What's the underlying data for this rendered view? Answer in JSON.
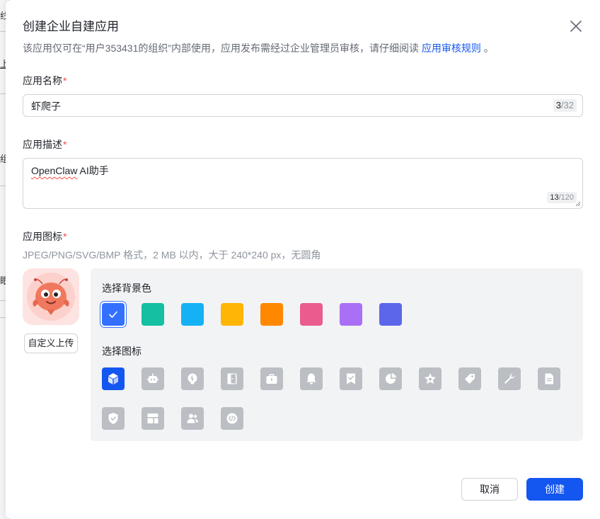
{
  "background": {
    "glyphs": [
      "线",
      "上",
      "组",
      "眼"
    ]
  },
  "dialog": {
    "title": "创建企业自建应用",
    "description_prefix": "该应用仅可在“用户353431的组织”内部使用，应用发布需经过企业管理员审核，请仔细阅读",
    "description_link": "应用审核规则",
    "description_suffix": "。"
  },
  "app_name": {
    "label": "应用名称",
    "required_mark": "*",
    "value": "虾爬子",
    "count": "3",
    "max": "/32"
  },
  "app_description": {
    "label": "应用描述",
    "required_mark": "*",
    "value_word": "OpenClaw",
    "value_rest": " AI助手",
    "count": "13",
    "max": "/120"
  },
  "app_icon": {
    "label": "应用图标",
    "required_mark": "*",
    "hint": "JPEG/PNG/SVG/BMP 格式，2 MB 以内，大于 240*240 px，无圆角",
    "upload_label": "自定义上传",
    "bg_color_label": "选择背景色",
    "icon_label": "选择图标",
    "colors": [
      "#3370ff",
      "#14c0a0",
      "#14b2f5",
      "#ffb505",
      "#ff8800",
      "#ea5b8e",
      "#a970f5",
      "#5b67e8"
    ],
    "selected_color_index": 0,
    "icons": [
      "cube-icon",
      "robot-icon",
      "lightbulb-icon",
      "door-icon",
      "briefcase-icon",
      "bell-icon",
      "check-badge-icon",
      "pie-chart-icon",
      "star-icon",
      "tag-icon",
      "wrench-icon",
      "document-icon",
      "shield-icon",
      "layout-icon",
      "users-icon",
      "code-icon"
    ],
    "selected_icon_index": 0
  },
  "footer": {
    "cancel_label": "取消",
    "create_label": "创建"
  }
}
